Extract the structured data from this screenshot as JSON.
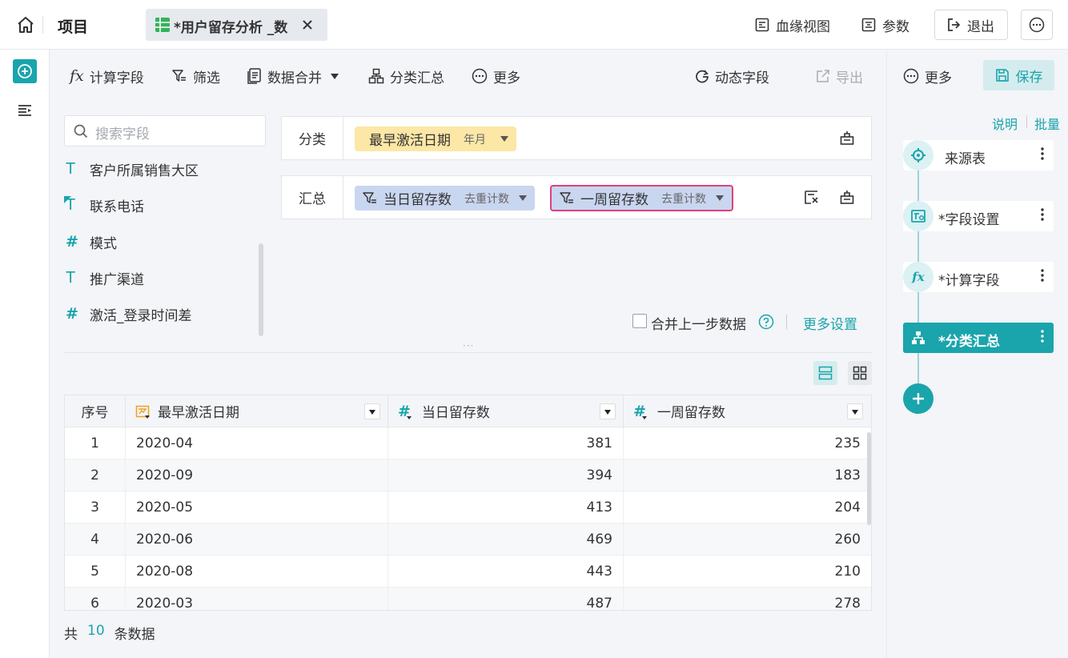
{
  "topbar": {
    "project_label": "项目",
    "tab_title": "*用户留存分析 _数",
    "lineage_label": "血缘视图",
    "params_label": "参数",
    "exit_label": "退出"
  },
  "toolbar": {
    "calc_field": "计算字段",
    "filter": "筛选",
    "merge": "数据合并",
    "group_summary": "分类汇总",
    "more": "更多",
    "dynamic_field": "动态字段",
    "export": "导出"
  },
  "right_panel": {
    "more": "更多",
    "save": "保存",
    "explain": "说明",
    "batch": "批量",
    "steps": [
      {
        "label": "来源表"
      },
      {
        "label": "*字段设置"
      },
      {
        "label": "*计算字段"
      },
      {
        "label": "*分类汇总"
      }
    ]
  },
  "fields": {
    "search_placeholder": "搜索字段",
    "items": [
      {
        "label": "客户所属销售大区",
        "type": "T"
      },
      {
        "label": "联系电话",
        "type": "T"
      },
      {
        "label": "模式",
        "type": "#"
      },
      {
        "label": "推广渠道",
        "type": "T"
      },
      {
        "label": "激活_登录时间差",
        "type": "#"
      }
    ]
  },
  "config": {
    "category_label": "分类",
    "category_chip": {
      "name": "最早激活日期",
      "sub": "年月"
    },
    "summary_label": "汇总",
    "summary_chips": [
      {
        "name": "当日留存数",
        "sub": "去重计数"
      },
      {
        "name": "一周留存数",
        "sub": "去重计数"
      }
    ],
    "merge_prev": "合并上一步数据",
    "more_settings": "更多设置"
  },
  "table": {
    "headers": [
      "序号",
      "最早激活日期",
      "当日留存数",
      "一周留存数"
    ],
    "rows": [
      [
        "1",
        "2020-04",
        "381",
        "235"
      ],
      [
        "2",
        "2020-09",
        "394",
        "183"
      ],
      [
        "3",
        "2020-05",
        "413",
        "204"
      ],
      [
        "4",
        "2020-06",
        "469",
        "260"
      ],
      [
        "5",
        "2020-08",
        "443",
        "210"
      ],
      [
        "6",
        "2020-03",
        "487",
        "278"
      ]
    ]
  },
  "footer": {
    "prefix": "共",
    "count": "10",
    "suffix": "条数据"
  },
  "colors": {
    "accent": "#1aa4ac",
    "category_chip": "#fde7a6",
    "summary_chip": "#c9d6f0",
    "highlight_border": "#e0407b"
  }
}
